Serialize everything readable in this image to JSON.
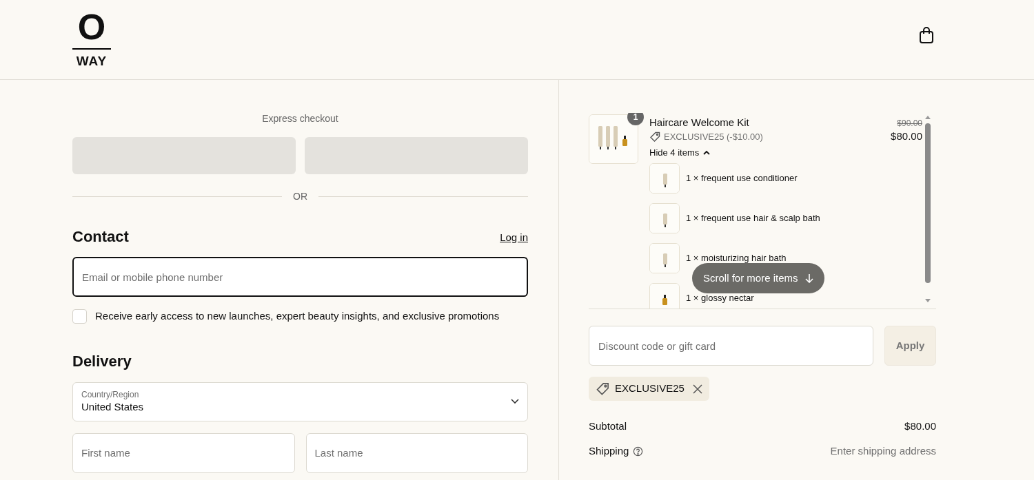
{
  "header": {
    "logo_letter": "O",
    "logo_word": "WAY"
  },
  "express_checkout": {
    "title": "Express checkout",
    "separator": "OR"
  },
  "contact": {
    "heading": "Contact",
    "login_link": "Log in",
    "email": {
      "placeholder": "Email or mobile phone number"
    },
    "marketing_opt_in": {
      "label": "Receive early access to new launches, expert beauty insights, and exclusive promotions",
      "checked": false
    }
  },
  "delivery": {
    "heading": "Delivery",
    "country": {
      "label": "Country/Region",
      "value": "United States"
    },
    "first_name": {
      "placeholder": "First name"
    },
    "last_name": {
      "placeholder": "Last name"
    }
  },
  "order": {
    "product": {
      "quantity_badge": "1",
      "name": "Haircare Welcome Kit",
      "discount": "EXCLUSIVE25 (-$10.00)",
      "original_price": "$90.00",
      "price": "$80.00",
      "toggle": "Hide 4 items",
      "expanded": true,
      "items": [
        {
          "label": "1 × frequent use conditioner",
          "kind": "tube"
        },
        {
          "label": "1 × frequent use hair & scalp bath",
          "kind": "tube"
        },
        {
          "label": "1 × moisturizing hair bath",
          "kind": "tube"
        },
        {
          "label": "1 × glossy nectar",
          "kind": "bottle"
        }
      ]
    },
    "scroll_hint": "Scroll for more items",
    "discount_field": {
      "placeholder": "Discount code or gift card"
    },
    "apply_button": "Apply",
    "applied_code": "EXCLUSIVE25",
    "summary": [
      {
        "label": "Subtotal",
        "value": "$80.00",
        "help": false
      },
      {
        "label": "Shipping",
        "value": "Enter shipping address",
        "help": true
      }
    ]
  }
}
